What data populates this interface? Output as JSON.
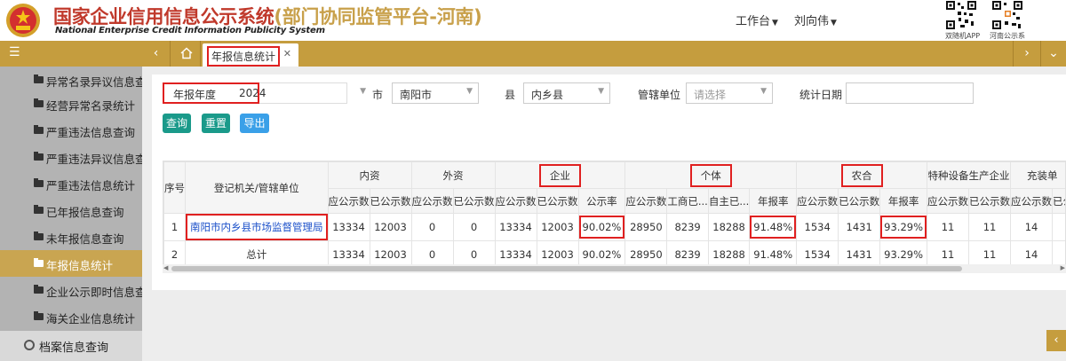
{
  "header": {
    "title_cn": "国家企业信用信息公示系统",
    "title_sub": "(部门协同监管平台-河南)",
    "title_en": "National Enterprise Credit Information Publicity System",
    "workbench_label": "工作台",
    "user_label": "刘向伟",
    "qr_app_label": "双随机APP",
    "qr_henan_label": "河南公示系"
  },
  "tabs": [
    {
      "label": "年报信息统计",
      "active": true
    }
  ],
  "sidebar": {
    "items": [
      {
        "label": "异常名录异议信息查"
      },
      {
        "label": "经营异常名录统计"
      },
      {
        "label": "严重违法信息查询"
      },
      {
        "label": "严重违法异议信息查"
      },
      {
        "label": "严重违法信息统计"
      },
      {
        "label": "已年报信息查询"
      },
      {
        "label": "未年报信息查询"
      },
      {
        "label": "年报信息统计",
        "active": true
      },
      {
        "label": "企业公示即时信息查"
      },
      {
        "label": "海关企业信息统计"
      }
    ],
    "archive_label": "档案信息查询"
  },
  "filters": {
    "year_label": "年报年度",
    "year_value": "2024",
    "city_label": "市",
    "city_value": "南阳市",
    "county_label": "县",
    "county_value": "内乡县",
    "unit_label": "管辖单位",
    "unit_placeholder": "请选择",
    "date_label": "统计日期",
    "date_value": ""
  },
  "buttons": {
    "query": "查询",
    "reset": "重置",
    "export": "导出"
  },
  "table": {
    "h_seq": "序号",
    "h_unit": "登记机关/管辖单位",
    "h_domestic": "内资",
    "h_foreign": "外资",
    "h_enterprise": "企业",
    "h_individual": "个体",
    "h_coop": "农合",
    "h_special": "特种设备生产企业",
    "h_charging": "充装单",
    "sub": {
      "should": "应公示数",
      "done": "已公示数",
      "rate": "公示率",
      "biz_done": "工商已...",
      "self_done": "自主已...",
      "annual_rate": "年报率"
    },
    "rows": [
      {
        "seq": "1",
        "unit": "南阳市内乡县市场监督管理局",
        "link": true,
        "cells": [
          "13334",
          "12003",
          "0",
          "0",
          "13334",
          "12003",
          "90.02%",
          "28950",
          "8239",
          "18288",
          "91.48%",
          "1534",
          "1431",
          "93.29%",
          "11",
          "11",
          "14"
        ]
      },
      {
        "seq": "2",
        "unit": "总计",
        "link": false,
        "cells": [
          "13334",
          "12003",
          "0",
          "0",
          "13334",
          "12003",
          "90.02%",
          "28950",
          "8239",
          "18288",
          "91.48%",
          "1534",
          "1431",
          "93.29%",
          "11",
          "11",
          "14"
        ]
      }
    ]
  },
  "colors": {
    "gold": "#c59d3e",
    "teal": "#1a9a8a",
    "blue": "#3aa0e8",
    "red_box": "#e02020",
    "brand_red": "#c0392b"
  },
  "icons": [
    "national-emblem-icon",
    "qr-code-icon",
    "hamburger-menu-icon",
    "chevron-left-icon",
    "home-icon",
    "close-icon",
    "chevron-right-icon",
    "chevron-down-icon",
    "folder-icon",
    "search-icon"
  ]
}
